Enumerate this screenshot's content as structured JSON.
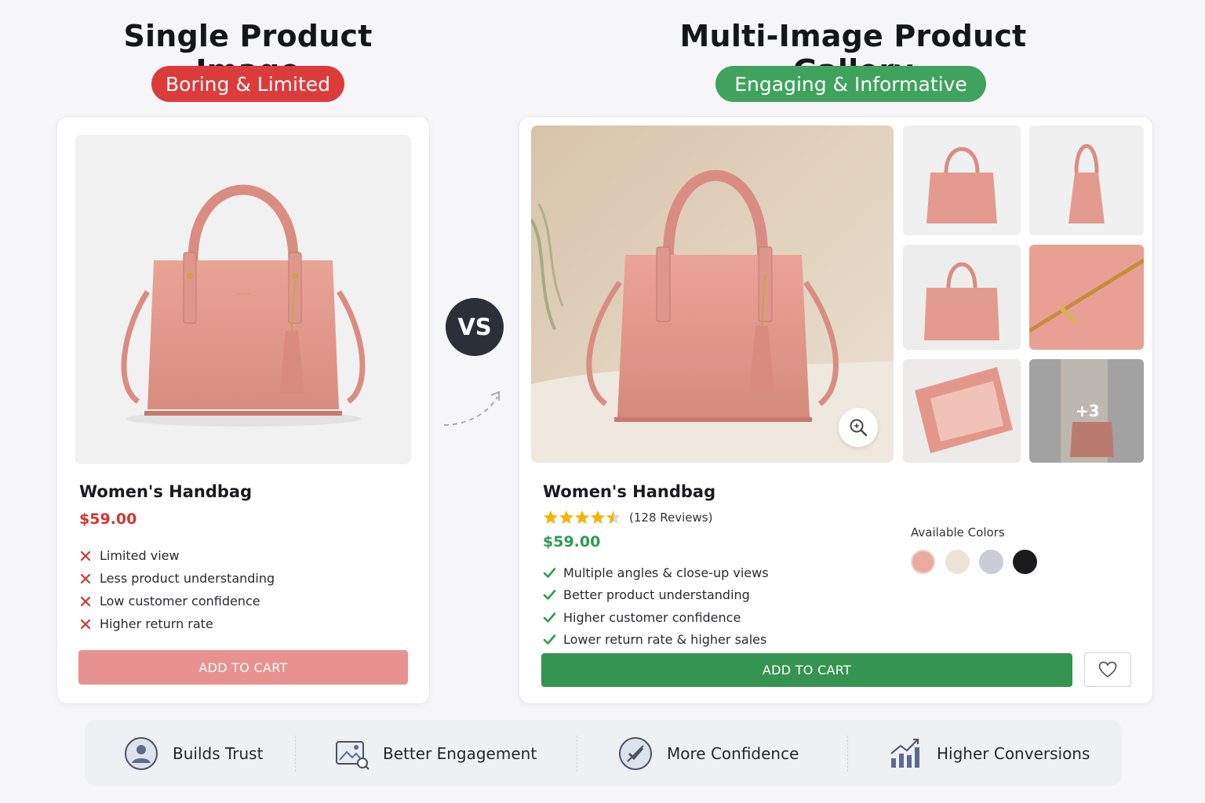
{
  "left": {
    "heading": "Single Product Image",
    "badge": "Boring & Limited",
    "product": {
      "title": "Women's Handbag",
      "price": "$59.00",
      "cons": [
        "Limited view",
        "Less product understanding",
        "Low customer confidence",
        "Higher return rate"
      ],
      "button": "ADD TO CART"
    }
  },
  "vs_label": "VS",
  "right": {
    "heading": "Multi-Image Product Gallery",
    "badge": "Engaging & Informative",
    "gallery": {
      "more_count": "+3"
    },
    "product": {
      "title": "Women's Handbag",
      "rating": 4.5,
      "reviews": "(128 Reviews)",
      "price": "$59.00",
      "pros": [
        "Multiple angles & close-up views",
        "Better product understanding",
        "Higher customer confidence",
        "Lower return rate & higher sales"
      ],
      "colors_label": "Available Colors",
      "colors": [
        "#e9aaa0",
        "#ece3d6",
        "#c8cdd8",
        "#1b1b1d"
      ],
      "button": "ADD TO CART"
    }
  },
  "benefits": [
    "Builds Trust",
    "Better Engagement",
    "More Confidence",
    "Higher Conversions"
  ],
  "colors": {
    "red": "#dc3b3c",
    "green": "#3fa25d",
    "bag_pink": "#e5968b"
  }
}
